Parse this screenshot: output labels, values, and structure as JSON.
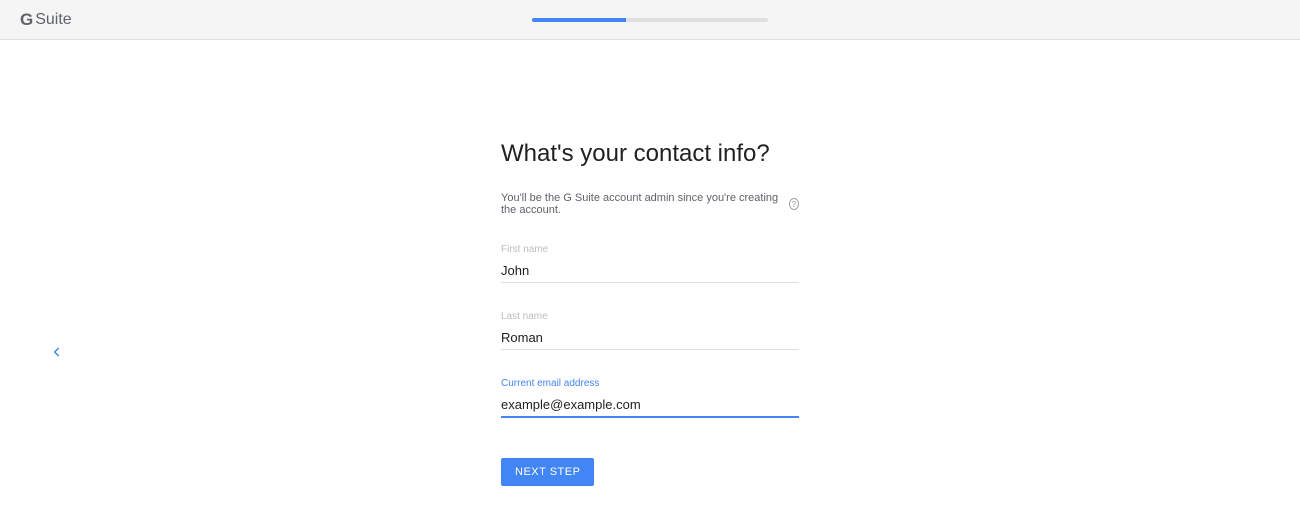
{
  "header": {
    "logo_prefix": "G",
    "logo_text": "Suite",
    "progress_percent": 40
  },
  "main": {
    "title": "What's your contact info?",
    "subtitle": "You'll be the G Suite account admin since you're creating the account.",
    "fields": {
      "first_name": {
        "label": "First name",
        "value": "John"
      },
      "last_name": {
        "label": "Last name",
        "value": "Roman"
      },
      "email": {
        "label": "Current email address",
        "value": "example@example.com"
      }
    },
    "next_button": "NEXT STEP"
  }
}
